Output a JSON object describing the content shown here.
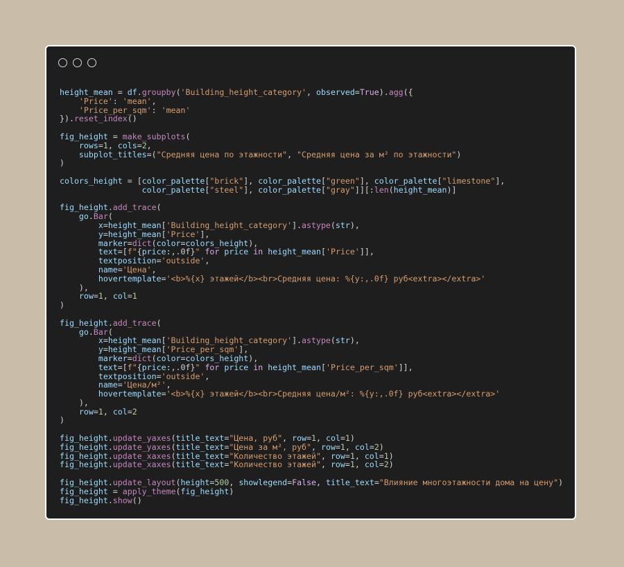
{
  "window": {
    "controls": [
      "window-control-1",
      "window-control-2",
      "window-control-3"
    ]
  },
  "code_lines": [
    [
      [
        "var",
        "height_mean"
      ],
      [
        "p",
        " = "
      ],
      [
        "var",
        "df"
      ],
      [
        "p",
        "."
      ],
      [
        "fn",
        "groupby"
      ],
      [
        "p",
        "("
      ],
      [
        "str",
        "'Building_height_category'"
      ],
      [
        "p",
        ", "
      ],
      [
        "var",
        "observed"
      ],
      [
        "p",
        "="
      ],
      [
        "kw",
        "True"
      ],
      [
        "p",
        ")."
      ],
      [
        "fn",
        "agg"
      ],
      [
        "p",
        "({"
      ]
    ],
    [
      [
        "p",
        "    "
      ],
      [
        "str",
        "'Price'"
      ],
      [
        "p",
        ": "
      ],
      [
        "str",
        "'mean'"
      ],
      [
        "p",
        ","
      ]
    ],
    [
      [
        "p",
        "    "
      ],
      [
        "str",
        "'Price_per_sqm'"
      ],
      [
        "p",
        ": "
      ],
      [
        "str",
        "'mean'"
      ]
    ],
    [
      [
        "p",
        "})."
      ],
      [
        "fn",
        "reset_index"
      ],
      [
        "p",
        "()"
      ]
    ],
    [],
    [
      [
        "var",
        "fig_height"
      ],
      [
        "p",
        " = "
      ],
      [
        "fn",
        "make_subplots"
      ],
      [
        "p",
        "("
      ]
    ],
    [
      [
        "p",
        "    "
      ],
      [
        "var",
        "rows"
      ],
      [
        "p",
        "="
      ],
      [
        "num",
        "1"
      ],
      [
        "p",
        ", "
      ],
      [
        "var",
        "cols"
      ],
      [
        "p",
        "="
      ],
      [
        "num",
        "2"
      ],
      [
        "p",
        ","
      ]
    ],
    [
      [
        "p",
        "    "
      ],
      [
        "var",
        "subplot_titles"
      ],
      [
        "p",
        "=("
      ],
      [
        "str",
        "\"Средняя цена по этажности\""
      ],
      [
        "p",
        ", "
      ],
      [
        "str",
        "\"Средняя цена за м² по этажности\""
      ],
      [
        "p",
        ")"
      ]
    ],
    [
      [
        "p",
        ")"
      ]
    ],
    [],
    [
      [
        "var",
        "colors_height"
      ],
      [
        "p",
        " = ["
      ],
      [
        "var",
        "color_palette"
      ],
      [
        "p",
        "["
      ],
      [
        "str",
        "\"brick\""
      ],
      [
        "p",
        "], "
      ],
      [
        "var",
        "color_palette"
      ],
      [
        "p",
        "["
      ],
      [
        "str",
        "\"green\""
      ],
      [
        "p",
        "], "
      ],
      [
        "var",
        "color_palette"
      ],
      [
        "p",
        "["
      ],
      [
        "str",
        "\"limestone\""
      ],
      [
        "p",
        "],"
      ]
    ],
    [
      [
        "p",
        "                 "
      ],
      [
        "var",
        "color_palette"
      ],
      [
        "p",
        "["
      ],
      [
        "str",
        "\"steel\""
      ],
      [
        "p",
        "], "
      ],
      [
        "var",
        "color_palette"
      ],
      [
        "p",
        "["
      ],
      [
        "str",
        "\"gray\""
      ],
      [
        "p",
        "]][:"
      ],
      [
        "fn",
        "len"
      ],
      [
        "p",
        "("
      ],
      [
        "var",
        "height_mean"
      ],
      [
        "p",
        ")]"
      ]
    ],
    [],
    [
      [
        "var",
        "fig_height"
      ],
      [
        "p",
        "."
      ],
      [
        "fn",
        "add_trace"
      ],
      [
        "p",
        "("
      ]
    ],
    [
      [
        "p",
        "    "
      ],
      [
        "var",
        "go"
      ],
      [
        "p",
        "."
      ],
      [
        "fn",
        "Bar"
      ],
      [
        "p",
        "("
      ]
    ],
    [
      [
        "p",
        "        "
      ],
      [
        "var",
        "x"
      ],
      [
        "p",
        "="
      ],
      [
        "var",
        "height_mean"
      ],
      [
        "p",
        "["
      ],
      [
        "str",
        "'Building_height_category'"
      ],
      [
        "p",
        "]."
      ],
      [
        "fn",
        "astype"
      ],
      [
        "p",
        "("
      ],
      [
        "var",
        "str"
      ],
      [
        "p",
        "),"
      ]
    ],
    [
      [
        "p",
        "        "
      ],
      [
        "var",
        "y"
      ],
      [
        "p",
        "="
      ],
      [
        "var",
        "height_mean"
      ],
      [
        "p",
        "["
      ],
      [
        "str",
        "'Price'"
      ],
      [
        "p",
        "],"
      ]
    ],
    [
      [
        "p",
        "        "
      ],
      [
        "var",
        "marker"
      ],
      [
        "p",
        "="
      ],
      [
        "fn",
        "dict"
      ],
      [
        "p",
        "("
      ],
      [
        "var",
        "color"
      ],
      [
        "p",
        "="
      ],
      [
        "var",
        "colors_height"
      ],
      [
        "p",
        "),"
      ]
    ],
    [
      [
        "p",
        "        "
      ],
      [
        "var",
        "text"
      ],
      [
        "p",
        "=["
      ],
      [
        "str",
        "f\""
      ],
      [
        "p",
        "{"
      ],
      [
        "var",
        "price"
      ],
      [
        "p",
        ":,.0f}"
      ],
      [
        "str",
        "\""
      ],
      [
        "p",
        " "
      ],
      [
        "kw",
        "for"
      ],
      [
        "p",
        " "
      ],
      [
        "var",
        "price"
      ],
      [
        "p",
        " "
      ],
      [
        "kw",
        "in"
      ],
      [
        "p",
        " "
      ],
      [
        "var",
        "height_mean"
      ],
      [
        "p",
        "["
      ],
      [
        "str",
        "'Price'"
      ],
      [
        "p",
        "]],"
      ]
    ],
    [
      [
        "p",
        "        "
      ],
      [
        "var",
        "textposition"
      ],
      [
        "p",
        "="
      ],
      [
        "str",
        "'outside'"
      ],
      [
        "p",
        ","
      ]
    ],
    [
      [
        "p",
        "        "
      ],
      [
        "var",
        "name"
      ],
      [
        "p",
        "="
      ],
      [
        "str",
        "'Цена'"
      ],
      [
        "p",
        ","
      ]
    ],
    [
      [
        "p",
        "        "
      ],
      [
        "var",
        "hovertemplate"
      ],
      [
        "p",
        "="
      ],
      [
        "str",
        "'<b>%{x} этажей</b><br>Средняя цена: %{y:,.0f} руб<extra></extra>'"
      ]
    ],
    [
      [
        "p",
        "    ),"
      ]
    ],
    [
      [
        "p",
        "    "
      ],
      [
        "var",
        "row"
      ],
      [
        "p",
        "="
      ],
      [
        "num",
        "1"
      ],
      [
        "p",
        ", "
      ],
      [
        "var",
        "col"
      ],
      [
        "p",
        "="
      ],
      [
        "num",
        "1"
      ]
    ],
    [
      [
        "p",
        ")"
      ]
    ],
    [],
    [
      [
        "var",
        "fig_height"
      ],
      [
        "p",
        "."
      ],
      [
        "fn",
        "add_trace"
      ],
      [
        "p",
        "("
      ]
    ],
    [
      [
        "p",
        "    "
      ],
      [
        "var",
        "go"
      ],
      [
        "p",
        "."
      ],
      [
        "fn",
        "Bar"
      ],
      [
        "p",
        "("
      ]
    ],
    [
      [
        "p",
        "        "
      ],
      [
        "var",
        "x"
      ],
      [
        "p",
        "="
      ],
      [
        "var",
        "height_mean"
      ],
      [
        "p",
        "["
      ],
      [
        "str",
        "'Building_height_category'"
      ],
      [
        "p",
        "]."
      ],
      [
        "fn",
        "astype"
      ],
      [
        "p",
        "("
      ],
      [
        "var",
        "str"
      ],
      [
        "p",
        "),"
      ]
    ],
    [
      [
        "p",
        "        "
      ],
      [
        "var",
        "y"
      ],
      [
        "p",
        "="
      ],
      [
        "var",
        "height_mean"
      ],
      [
        "p",
        "["
      ],
      [
        "str",
        "'Price_per_sqm'"
      ],
      [
        "p",
        "],"
      ]
    ],
    [
      [
        "p",
        "        "
      ],
      [
        "var",
        "marker"
      ],
      [
        "p",
        "="
      ],
      [
        "fn",
        "dict"
      ],
      [
        "p",
        "("
      ],
      [
        "var",
        "color"
      ],
      [
        "p",
        "="
      ],
      [
        "var",
        "colors_height"
      ],
      [
        "p",
        "),"
      ]
    ],
    [
      [
        "p",
        "        "
      ],
      [
        "var",
        "text"
      ],
      [
        "p",
        "=["
      ],
      [
        "str",
        "f\""
      ],
      [
        "p",
        "{"
      ],
      [
        "var",
        "price"
      ],
      [
        "p",
        ":,.0f}"
      ],
      [
        "str",
        "\""
      ],
      [
        "p",
        " "
      ],
      [
        "kw",
        "for"
      ],
      [
        "p",
        " "
      ],
      [
        "var",
        "price"
      ],
      [
        "p",
        " "
      ],
      [
        "kw",
        "in"
      ],
      [
        "p",
        " "
      ],
      [
        "var",
        "height_mean"
      ],
      [
        "p",
        "["
      ],
      [
        "str",
        "'Price_per_sqm'"
      ],
      [
        "p",
        "]],"
      ]
    ],
    [
      [
        "p",
        "        "
      ],
      [
        "var",
        "textposition"
      ],
      [
        "p",
        "="
      ],
      [
        "str",
        "'outside'"
      ],
      [
        "p",
        ","
      ]
    ],
    [
      [
        "p",
        "        "
      ],
      [
        "var",
        "name"
      ],
      [
        "p",
        "="
      ],
      [
        "str",
        "'Цена/м²'"
      ],
      [
        "p",
        ","
      ]
    ],
    [
      [
        "p",
        "        "
      ],
      [
        "var",
        "hovertemplate"
      ],
      [
        "p",
        "="
      ],
      [
        "str",
        "'<b>%{x} этажей</b><br>Средняя цена/м²: %{y:,.0f} руб<extra></extra>'"
      ]
    ],
    [
      [
        "p",
        "    ),"
      ]
    ],
    [
      [
        "p",
        "    "
      ],
      [
        "var",
        "row"
      ],
      [
        "p",
        "="
      ],
      [
        "num",
        "1"
      ],
      [
        "p",
        ", "
      ],
      [
        "var",
        "col"
      ],
      [
        "p",
        "="
      ],
      [
        "num",
        "2"
      ]
    ],
    [
      [
        "p",
        ")"
      ]
    ],
    [],
    [
      [
        "var",
        "fig_height"
      ],
      [
        "p",
        "."
      ],
      [
        "fn",
        "update_yaxes"
      ],
      [
        "p",
        "("
      ],
      [
        "var",
        "title_text"
      ],
      [
        "p",
        "="
      ],
      [
        "str",
        "\"Цена, руб\""
      ],
      [
        "p",
        ", "
      ],
      [
        "var",
        "row"
      ],
      [
        "p",
        "="
      ],
      [
        "num",
        "1"
      ],
      [
        "p",
        ", "
      ],
      [
        "var",
        "col"
      ],
      [
        "p",
        "="
      ],
      [
        "num",
        "1"
      ],
      [
        "p",
        ")"
      ]
    ],
    [
      [
        "var",
        "fig_height"
      ],
      [
        "p",
        "."
      ],
      [
        "fn",
        "update_yaxes"
      ],
      [
        "p",
        "("
      ],
      [
        "var",
        "title_text"
      ],
      [
        "p",
        "="
      ],
      [
        "str",
        "\"Цена за м², руб\""
      ],
      [
        "p",
        ", "
      ],
      [
        "var",
        "row"
      ],
      [
        "p",
        "="
      ],
      [
        "num",
        "1"
      ],
      [
        "p",
        ", "
      ],
      [
        "var",
        "col"
      ],
      [
        "p",
        "="
      ],
      [
        "num",
        "2"
      ],
      [
        "p",
        ")"
      ]
    ],
    [
      [
        "var",
        "fig_height"
      ],
      [
        "p",
        "."
      ],
      [
        "fn",
        "update_xaxes"
      ],
      [
        "p",
        "("
      ],
      [
        "var",
        "title_text"
      ],
      [
        "p",
        "="
      ],
      [
        "str",
        "\"Количество этажей\""
      ],
      [
        "p",
        ", "
      ],
      [
        "var",
        "row"
      ],
      [
        "p",
        "="
      ],
      [
        "num",
        "1"
      ],
      [
        "p",
        ", "
      ],
      [
        "var",
        "col"
      ],
      [
        "p",
        "="
      ],
      [
        "num",
        "1"
      ],
      [
        "p",
        ")"
      ]
    ],
    [
      [
        "var",
        "fig_height"
      ],
      [
        "p",
        "."
      ],
      [
        "fn",
        "update_xaxes"
      ],
      [
        "p",
        "("
      ],
      [
        "var",
        "title_text"
      ],
      [
        "p",
        "="
      ],
      [
        "str",
        "\"Количество этажей\""
      ],
      [
        "p",
        ", "
      ],
      [
        "var",
        "row"
      ],
      [
        "p",
        "="
      ],
      [
        "num",
        "1"
      ],
      [
        "p",
        ", "
      ],
      [
        "var",
        "col"
      ],
      [
        "p",
        "="
      ],
      [
        "num",
        "2"
      ],
      [
        "p",
        ")"
      ]
    ],
    [],
    [
      [
        "var",
        "fig_height"
      ],
      [
        "p",
        "."
      ],
      [
        "fn",
        "update_layout"
      ],
      [
        "p",
        "("
      ],
      [
        "var",
        "height"
      ],
      [
        "p",
        "="
      ],
      [
        "num",
        "500"
      ],
      [
        "p",
        ", "
      ],
      [
        "var",
        "showlegend"
      ],
      [
        "p",
        "="
      ],
      [
        "kw",
        "False"
      ],
      [
        "p",
        ", "
      ],
      [
        "var",
        "title_text"
      ],
      [
        "p",
        "="
      ],
      [
        "str",
        "\"Влияние многоэтажности дома на цену\""
      ],
      [
        "p",
        ")"
      ]
    ],
    [
      [
        "var",
        "fig_height"
      ],
      [
        "p",
        " = "
      ],
      [
        "fn",
        "apply_theme"
      ],
      [
        "p",
        "("
      ],
      [
        "var",
        "fig_height"
      ],
      [
        "p",
        ")"
      ]
    ],
    [
      [
        "var",
        "fig_height"
      ],
      [
        "p",
        "."
      ],
      [
        "fn",
        "show"
      ],
      [
        "p",
        "()"
      ]
    ]
  ]
}
